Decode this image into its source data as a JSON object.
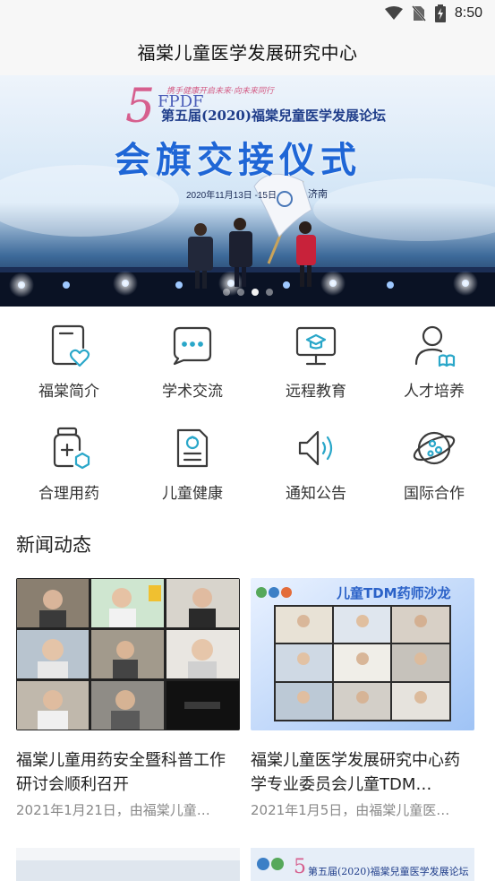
{
  "status_bar": {
    "time": "8:50"
  },
  "header": {
    "title": "福棠儿童医学发展研究中心"
  },
  "banner": {
    "slogan_small": "携手健康开启未来·向未来同行",
    "logo_text": "FPDF",
    "forum_title": "第五届(2020)福棠兒童医学发展论坛",
    "headline": "会旗交接仪式",
    "date_text": "2020年11月13日 -15日",
    "city": "济南",
    "slide_count": 4,
    "active_slide": 2
  },
  "nav": {
    "items": [
      {
        "label": "福棠简介",
        "icon": "tablet-heart-icon"
      },
      {
        "label": "学术交流",
        "icon": "chat-bubbles-icon"
      },
      {
        "label": "远程教育",
        "icon": "monitor-graduation-icon"
      },
      {
        "label": "人才培养",
        "icon": "person-book-icon"
      },
      {
        "label": "合理用药",
        "icon": "medicine-bottle-icon"
      },
      {
        "label": "儿童健康",
        "icon": "child-document-icon"
      },
      {
        "label": "通知公告",
        "icon": "speaker-icon"
      },
      {
        "label": "国际合作",
        "icon": "globe-icon"
      }
    ]
  },
  "news": {
    "section_title": "新闻动态",
    "items": [
      {
        "title": "福棠儿童用药安全暨科普工作研讨会顺利召开",
        "meta": "2021年1月21日，由福棠儿童…"
      },
      {
        "title": "福棠儿童医学发展研究中心药学专业委员会儿童TDM…",
        "meta": "2021年1月5日，由福棠儿童医…",
        "thumb_banner": "儿童TDM药师沙龙"
      }
    ],
    "peek_text": "第五届(2020)福棠兒童医学发展论坛"
  },
  "colors": {
    "accent": "#2aa7c9",
    "icon_stroke": "#3b3b3b"
  }
}
